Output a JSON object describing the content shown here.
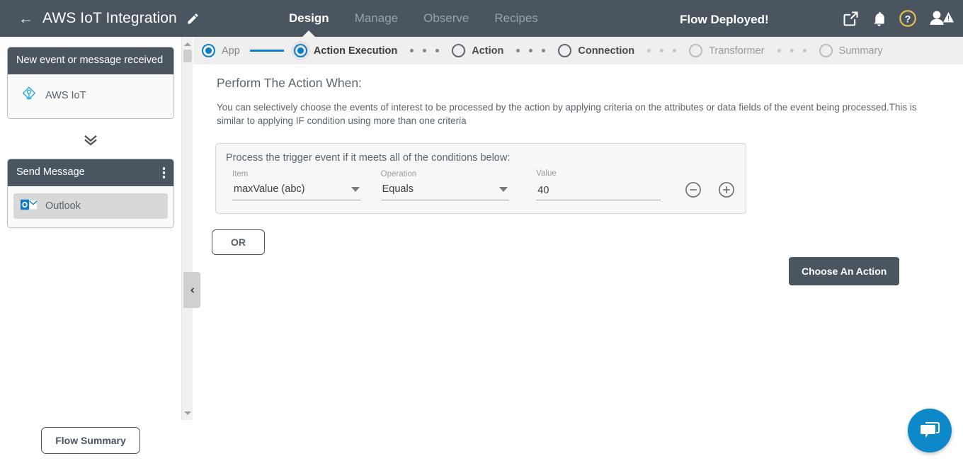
{
  "header": {
    "back_icon": "back-arrow-icon",
    "flow_title": "AWS IoT Integration",
    "edit_icon": "pencil-icon",
    "tabs": [
      {
        "label": "Design",
        "active": true
      },
      {
        "label": "Manage",
        "active": false
      },
      {
        "label": "Observe",
        "active": false
      },
      {
        "label": "Recipes",
        "active": false
      }
    ],
    "status_message": "Flow Deployed!",
    "icons": [
      {
        "name": "open-external-icon"
      },
      {
        "name": "notifications-bell-icon"
      },
      {
        "name": "help-question-icon"
      },
      {
        "name": "user-account-warning-icon"
      }
    ],
    "background_color": "#4a5560"
  },
  "stepper": {
    "steps": [
      {
        "label": "App",
        "state": "done"
      },
      {
        "label": "Action Execution",
        "state": "active"
      },
      {
        "label": "Action",
        "state": "pending"
      },
      {
        "label": "Connection",
        "state": "pending"
      },
      {
        "label": "Transformer",
        "state": "disabled"
      },
      {
        "label": "Summary",
        "state": "disabled"
      }
    ],
    "accent_color": "#0d7dc1"
  },
  "sidebar": {
    "trigger_card": {
      "title": "New event or message received",
      "app_name": "AWS IoT",
      "app_icon": "aws-iot-icon",
      "selected": false
    },
    "action_card": {
      "title": "Send Message",
      "menu_icon": "kebab-menu-icon",
      "app_name": "Outlook",
      "app_icon": "outlook-icon",
      "selected": true
    },
    "expand_icon": "double-chevron-down-icon",
    "collapse_icon": "chevron-left-icon",
    "flow_summary_label": "Flow Summary"
  },
  "main": {
    "page_title": "Perform The Action When:",
    "page_description": "You can selectively choose the events of interest to be processed by the action by applying criteria on the attributes or data fields of the event being processed.This is similar to applying IF condition using more than one criteria",
    "condition_panel": {
      "title": "Process the trigger event if it meets all of the conditions below:",
      "fields": {
        "item": {
          "label": "Item",
          "value": "maxValue (abc)"
        },
        "operation": {
          "label": "Operation",
          "value": "Equals"
        },
        "value": {
          "label": "Value",
          "value": "40",
          "placeholder": ""
        }
      },
      "remove_icon": "minus-circle-icon",
      "add_icon": "plus-circle-icon"
    },
    "or_button_label": "OR",
    "choose_action_label": "Choose An Action"
  },
  "chat": {
    "icon": "chat-bubble-icon",
    "color": "#0d88c9"
  }
}
